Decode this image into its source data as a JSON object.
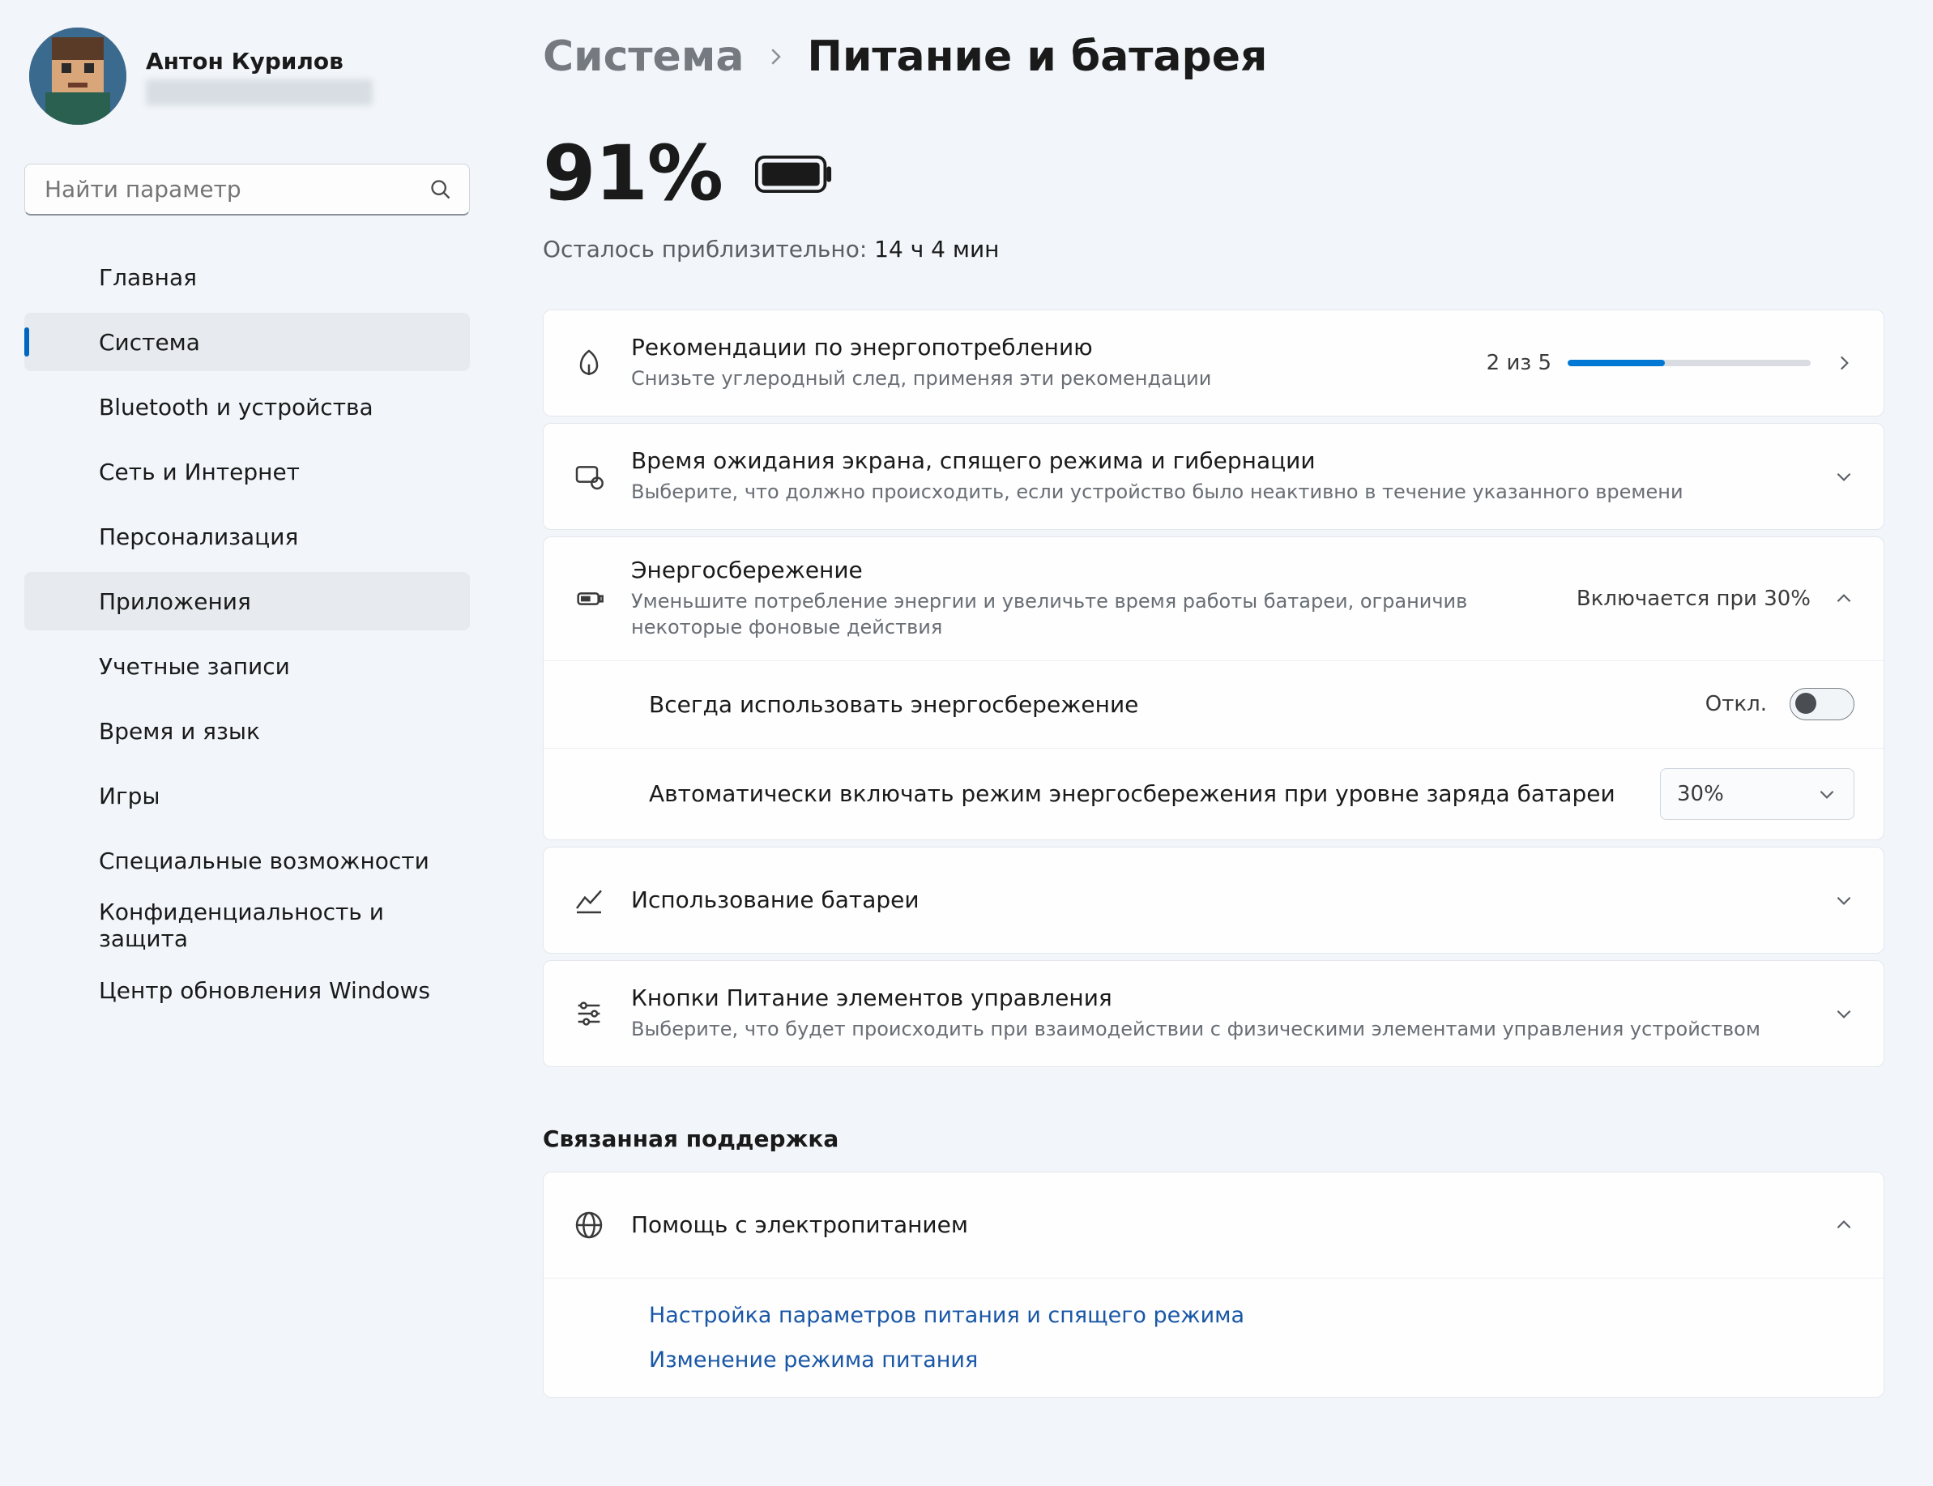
{
  "profile": {
    "name": "Антон Курилов"
  },
  "search": {
    "placeholder": "Найти параметр"
  },
  "nav": {
    "items": [
      "Главная",
      "Система",
      "Bluetooth и устройства",
      "Сеть и Интернет",
      "Персонализация",
      "Приложения",
      "Учетные записи",
      "Время и язык",
      "Игры",
      "Специальные возможности",
      "Конфиденциальность и защита",
      "Центр обновления Windows"
    ],
    "active_index": 1,
    "hover_index": 5
  },
  "breadcrumb": {
    "parent": "Система",
    "current": "Питание и батарея"
  },
  "battery": {
    "percent_label": "91%",
    "percent_value": 91,
    "eta_prefix": "Осталось приблизительно:",
    "eta_value": "14 ч 4 мин"
  },
  "rec": {
    "title": "Рекомендации по энергопотреблению",
    "desc": "Снизьте углеродный след, применяя эти рекомендации",
    "progress_label": "2 из 5",
    "progress_done": 2,
    "progress_total": 5
  },
  "screen": {
    "title": "Время ожидания экрана, спящего режима и гибернации",
    "desc": "Выберите, что должно происходить, если устройство было неактивно в течение указанного времени"
  },
  "saver": {
    "title": "Энергосбережение",
    "desc": "Уменьшите потребление энергии и увеличьте время работы батареи, ограничив некоторые фоновые действия",
    "state": "Включается при 30%",
    "always_label": "Всегда использовать энергосбережение",
    "always_state": "Откл.",
    "auto_label": "Автоматически включать режим энергосбережения при уровне заряда батареи",
    "auto_value": "30%"
  },
  "usage": {
    "title": "Использование батареи"
  },
  "controls": {
    "title": "Кнопки Питание элементов управления",
    "desc": "Выберите, что будет происходить при взаимодействии с физическими элементами управления устройством"
  },
  "support": {
    "heading": "Связанная поддержка",
    "help_title": "Помощь с электропитанием",
    "links": [
      "Настройка параметров питания и спящего режима",
      "Изменение режима питания"
    ]
  }
}
